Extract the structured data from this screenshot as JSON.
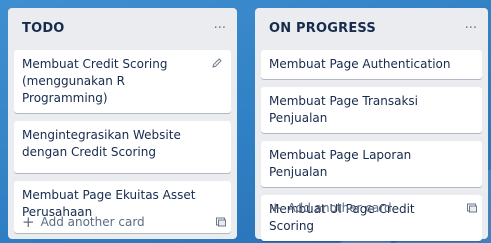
{
  "lists": [
    {
      "title": "TODO",
      "menu_glyph": "...",
      "cards": [
        "Membuat Credit Scoring (menggunakan R Programming)",
        "Mengintegrasikan Website dengan Credit Scoring",
        "Membuat Page Ekuitas Asset Perusahaan"
      ],
      "add_label": "Add another card"
    },
    {
      "title": "ON PROGRESS",
      "menu_glyph": "...",
      "cards": [
        "Membuat Page Authentication",
        "Membuat Page Transaksi Penjualan",
        "Membuat Page Laporan Penjualan",
        "Membuat UI Page Credit Scoring"
      ],
      "add_label": "Add another card"
    }
  ],
  "icons": {
    "plus": "+",
    "edit": "pencil-icon",
    "template": "card-template-icon"
  },
  "colors": {
    "board_bg": "#2f7fc4",
    "list_bg": "#ebecf0",
    "card_bg": "#ffffff",
    "text": "#172b4d",
    "muted": "#5e6c84"
  }
}
